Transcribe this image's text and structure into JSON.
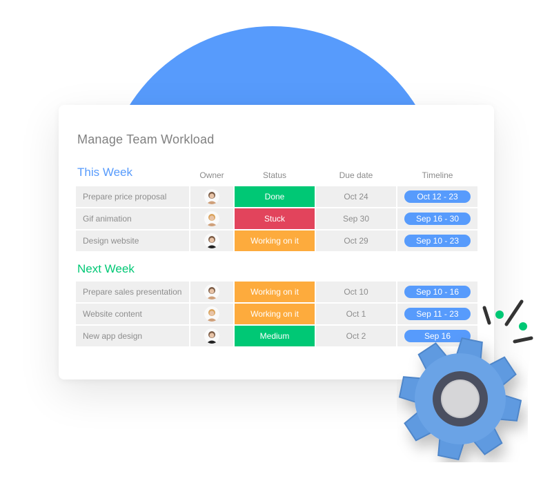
{
  "title": "Manage Team Workload",
  "columns": {
    "owner": "Owner",
    "status": "Status",
    "due_date": "Due date",
    "timeline": "Timeline"
  },
  "colors": {
    "accent_blue": "#579bfc",
    "this_week": "#579bfc",
    "next_week": "#00c875",
    "done": "#00c875",
    "stuck": "#e2445c",
    "working": "#fdab3d",
    "medium": "#00c875"
  },
  "groups": [
    {
      "title": "This Week",
      "color": "#579bfc",
      "rows": [
        {
          "name": "Prepare price proposal",
          "owner": "woman-brown-hair-avatar",
          "status": "Done",
          "status_color": "#00c875",
          "due": "Oct 24",
          "timeline": "Oct 12 - 23"
        },
        {
          "name": "Gif animation",
          "owner": "person-bear-hat-avatar",
          "status": "Stuck",
          "status_color": "#e2445c",
          "due": "Sep 30",
          "timeline": "Sep 16 - 30"
        },
        {
          "name": "Design website",
          "owner": "man-beard-avatar",
          "status": "Working on it",
          "status_color": "#fdab3d",
          "due": "Oct 29",
          "timeline": "Sep 10 - 23"
        }
      ]
    },
    {
      "title": "Next Week",
      "color": "#00c875",
      "rows": [
        {
          "name": "Prepare sales presentation",
          "owner": "person-glasses-avatar",
          "status": "Working on it",
          "status_color": "#fdab3d",
          "due": "Oct 10",
          "timeline": "Sep 10 - 16"
        },
        {
          "name": "Website content",
          "owner": "person-bear-hat-avatar",
          "status": "Working on it",
          "status_color": "#fdab3d",
          "due": "Oct 1",
          "timeline": "Sep 11 - 23"
        },
        {
          "name": "New app design",
          "owner": "man-beard-avatar",
          "status": "Medium",
          "status_color": "#00c875",
          "due": "Oct 2",
          "timeline": "Sep 16"
        }
      ]
    }
  ],
  "decorations": {
    "gear": "gear-icon",
    "sparkles": "sparkle-lines-icon"
  }
}
